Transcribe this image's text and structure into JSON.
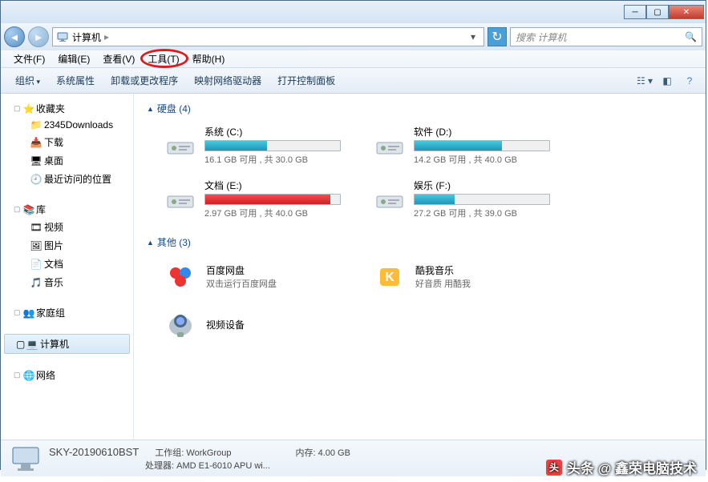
{
  "window": {
    "address": "计算机",
    "search_placeholder": "搜索 计算机"
  },
  "menubar": [
    "文件(F)",
    "编辑(E)",
    "查看(V)",
    "工具(T)",
    "帮助(H)"
  ],
  "toolbar": {
    "organize": "组织",
    "items": [
      "系统属性",
      "卸载或更改程序",
      "映射网络驱动器",
      "打开控制面板"
    ]
  },
  "sidebar": {
    "favorites": {
      "label": "收藏夹",
      "items": [
        "2345Downloads",
        "下载",
        "桌面",
        "最近访问的位置"
      ]
    },
    "library": {
      "label": "库",
      "items": [
        "视频",
        "图片",
        "文档",
        "音乐"
      ]
    },
    "homegroup": {
      "label": "家庭组"
    },
    "computer": {
      "label": "计算机"
    },
    "network": {
      "label": "网络"
    }
  },
  "content": {
    "drives_header": "硬盘 (4)",
    "drives": [
      {
        "name": "系统 (C:)",
        "stat": "16.1 GB 可用 , 共 30.0 GB",
        "fill": 46,
        "red": false
      },
      {
        "name": "软件 (D:)",
        "stat": "14.2 GB 可用 , 共 40.0 GB",
        "fill": 65,
        "red": false
      },
      {
        "name": "文档 (E:)",
        "stat": "2.97 GB 可用 , 共 40.0 GB",
        "fill": 93,
        "red": true
      },
      {
        "name": "娱乐 (F:)",
        "stat": "27.2 GB 可用 , 共 39.0 GB",
        "fill": 30,
        "red": false
      }
    ],
    "others_header": "其他 (3)",
    "others": [
      {
        "name": "百度网盘",
        "sub": "双击运行百度网盘"
      },
      {
        "name": "酷我音乐",
        "sub": "好音质 用酷我"
      },
      {
        "name": "视频设备",
        "sub": ""
      }
    ]
  },
  "status": {
    "name": "SKY-20190610BST",
    "workgroup_lbl": "工作组:",
    "workgroup": "WorkGroup",
    "cpu_lbl": "处理器:",
    "cpu": "AMD E1-6010 APU wi...",
    "mem_lbl": "内存:",
    "mem": "4.00 GB"
  },
  "watermark": "头条 @ 鑫荣电脑技术"
}
